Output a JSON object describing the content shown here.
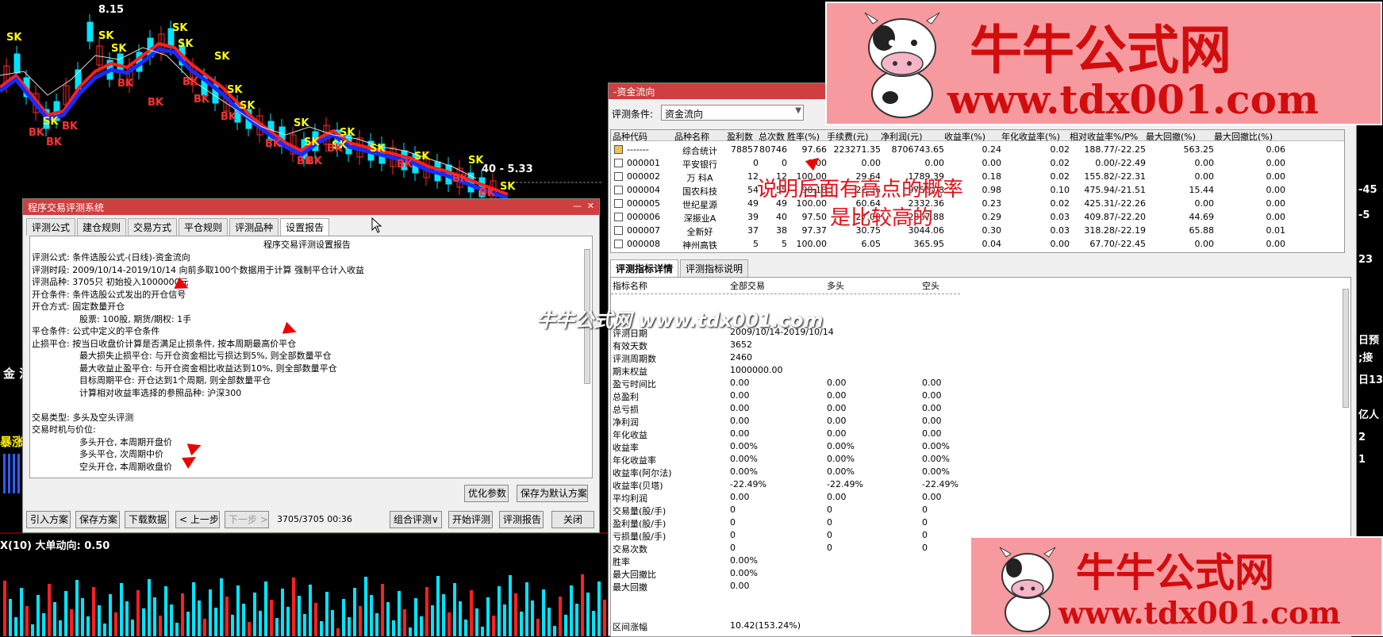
{
  "chart": {
    "price_high": "8.15",
    "price_low": "40 - 5.33",
    "bottom_label": "X(10)  大单动向: 0.50",
    "left_text_1": "金 流",
    "left_text_2": "暴涨",
    "sk": "SK",
    "bk": "BK",
    "right_edge": [
      "-45",
      "-5",
      "23",
      "日预",
      ";接",
      "日13",
      "亿人",
      "2",
      "1"
    ]
  },
  "eval_window": {
    "title": "程序交易评测系统",
    "tabs": [
      "评测公式",
      "建仓规则",
      "交易方式",
      "平仓规则",
      "评测品种",
      "设置报告"
    ],
    "report_title": "程序交易评测设置报告",
    "lines": [
      "评测公式: 条件选股公式-(日线)-资金流向",
      "评测时段: 2009/10/14-2019/10/14 向前多取100个数据用于计算 强制平仓计入收益",
      "评测品种: 3705只 初始投入1000000元",
      "开仓条件: 条件选股公式发出的开仓信号",
      "开仓方式: 固定数量开仓",
      "股票: 100股, 期货/期权: 1手",
      "平仓条件: 公式中定义的平仓条件",
      "止损平仓: 按当日收盘价计算是否满足止损条件, 按本周期最高价平仓",
      "最大损失止损平仓: 与开仓资金相比亏损达到5%, 则全部数量平仓",
      "最大收益止盈平仓: 与开仓资金相比收益达到10%, 则全部数量平仓",
      "目标周期平仓: 开仓达到1个周期, 则全部数量平仓",
      "计算相对收益率选择的参照品种: 沪深300",
      "",
      "交易类型: 多头及空头评测",
      "交易时机与价位:",
      "多头开仓, 本周期开盘价",
      "多头平仓, 次周期中价",
      "空头开仓, 本周期收盘价"
    ],
    "optimize": "优化参数",
    "save_default": "保存为默认方案",
    "import": "引入方案",
    "save_plan": "保存方案",
    "download": "下载数据",
    "prev": "< 上一步",
    "next": "下一步 >",
    "progress": "3705/3705  00:36",
    "combo": "组合评测∨",
    "start": "开始评测",
    "report": "评测报告",
    "close": "关闭"
  },
  "result_window": {
    "title": "-资金流向",
    "cond_label": "评测条件:",
    "cond_value": "资金流向",
    "columns": [
      "品种代码",
      "品种名称",
      "盈利数",
      "总次数",
      "胜率(%)",
      "手续费(元)",
      "净利润(元)",
      "收益率(%)",
      "年化收益率(%)",
      "相对收益率%/P%",
      "最大回撤(%)",
      "最大回撤比(%)"
    ],
    "rows": [
      [
        "-------",
        "综合统计",
        "78857",
        "80746",
        "97.66",
        "223271.35",
        "8706743.65",
        "0.24",
        "0.02",
        "188.77/-22.25",
        "563.25",
        "0.06"
      ],
      [
        "000001",
        "平安银行",
        "0",
        "0",
        "0.00",
        "0.00",
        "0.00",
        "0.00",
        "0.02",
        "0.00/-22.49",
        "0.00",
        "0.00"
      ],
      [
        "000002",
        "万 科A",
        "12",
        "12",
        "100.00",
        "29.64",
        "1789.39",
        "0.18",
        "0.02",
        "155.82/-22.31",
        "0.00",
        "0.00"
      ],
      [
        "000004",
        "国农科技",
        "54",
        "55",
        "98.18",
        "22.36",
        "9756.08",
        "0.98",
        "0.10",
        "475.94/-21.51",
        "15.44",
        "0.00"
      ],
      [
        "000005",
        "世纪星源",
        "49",
        "49",
        "100.00",
        "60.64",
        "2332.36",
        "0.23",
        "0.02",
        "425.31/-22.26",
        "0.00",
        "0.00"
      ],
      [
        "000006",
        "深振业A",
        "39",
        "40",
        "97.50",
        "27.00",
        "2867.88",
        "0.29",
        "0.03",
        "409.87/-22.20",
        "44.69",
        "0.00"
      ],
      [
        "000007",
        "全新好",
        "37",
        "38",
        "97.37",
        "30.75",
        "3044.06",
        "0.30",
        "0.03",
        "318.28/-22.19",
        "65.88",
        "0.01"
      ],
      [
        "000008",
        "神州高铁",
        "5",
        "5",
        "100.00",
        "6.05",
        "365.95",
        "0.04",
        "0.00",
        "67.70/-22.45",
        "0.00",
        "0.00"
      ]
    ],
    "tabs": [
      "评测指标详情",
      "评测指标说明"
    ],
    "ind_cols": [
      "指标名称",
      "全部交易",
      "多头",
      "空头"
    ],
    "ind_rows": [
      [
        "评测日期",
        "2009/10/14-2019/10/14",
        "",
        ""
      ],
      [
        "有效天数",
        "3652",
        "",
        ""
      ],
      [
        "评测周期数",
        "2460",
        "",
        ""
      ],
      [
        "期末权益",
        "1000000.00",
        "",
        ""
      ],
      [
        "盈亏时间比",
        "0.00",
        "0.00",
        "0.00"
      ],
      [
        "总盈利",
        "0.00",
        "0.00",
        "0.00"
      ],
      [
        "总亏损",
        "0.00",
        "0.00",
        "0.00"
      ],
      [
        "净利润",
        "0.00",
        "0.00",
        "0.00"
      ],
      [
        "年化收益",
        "0.00",
        "0.00",
        "0.00"
      ],
      [
        "收益率",
        "0.00%",
        "0.00%",
        "0.00%"
      ],
      [
        "年化收益率",
        "0.00%",
        "0.00%",
        "0.00%"
      ],
      [
        "收益率(阿尔法)",
        "0.00%",
        "0.00%",
        "0.00%"
      ],
      [
        "收益率(贝塔)",
        "-22.49%",
        "-22.49%",
        "-22.49%"
      ],
      [
        "平均利润",
        "0.00",
        "0.00",
        "0.00"
      ],
      [
        "交易量(股/手)",
        "0",
        "0",
        "0"
      ],
      [
        "盈利量(股/手)",
        "0",
        "0",
        "0"
      ],
      [
        "亏损量(股/手)",
        "0",
        "0",
        "0"
      ],
      [
        "交易次数",
        "0",
        "0",
        "0"
      ],
      [
        "胜率",
        "0.00%",
        "",
        ""
      ],
      [
        "最大回撤比",
        "0.00%",
        "",
        ""
      ],
      [
        "最大回撤",
        "0.00",
        "",
        ""
      ]
    ],
    "range_label": "区间涨幅",
    "range_value": "10.42(153.24%)"
  },
  "annotation": {
    "line1": "说明后面有高点的概率",
    "line2": "是比较高的"
  },
  "watermark": "牛牛公式网 www.tdx001.com",
  "banner": {
    "title": "牛牛公式网",
    "url": "www.tdx001.com"
  },
  "colors": {
    "titlebar": "#cf3f3f",
    "banner_bg": "#f69aa0",
    "banner_text": "#d10d0d",
    "annotation": "#e0101a"
  }
}
